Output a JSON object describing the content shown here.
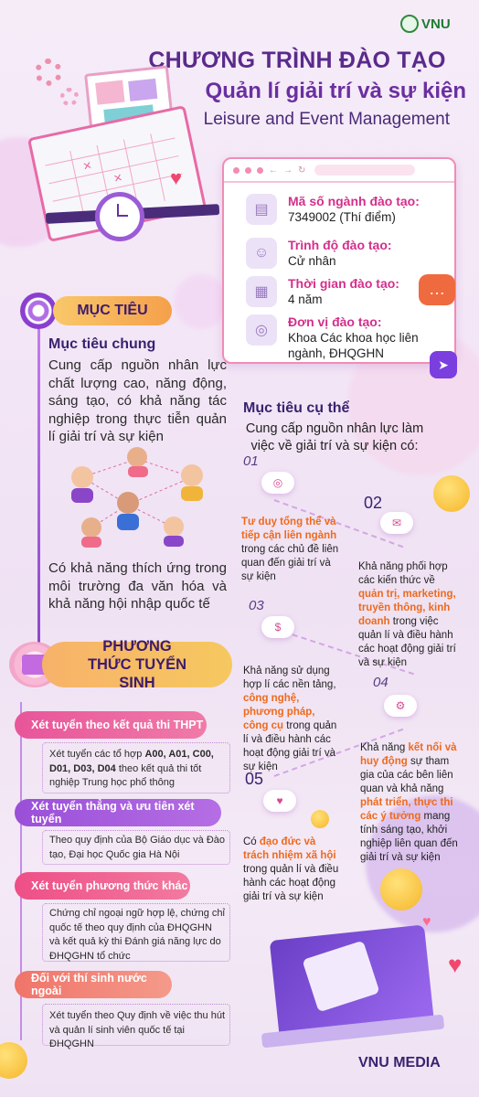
{
  "header": {
    "logo_text": "VNU",
    "title_line1": "CHƯƠNG TRÌNH ĐÀO TẠO",
    "title_line2": "Quản lí giải trí và sự kiện",
    "title_line3": "Leisure and Event Management"
  },
  "info_card": {
    "items": [
      {
        "icon": "document-icon",
        "label": "Mã số ngành đào tạo:",
        "value": "7349002 (Thí điểm)"
      },
      {
        "icon": "graduate-icon",
        "label": "Trình độ đào tạo:",
        "value": "Cử nhân"
      },
      {
        "icon": "calendar-icon",
        "label": "Thời gian đào tạo:",
        "value": "4 năm"
      },
      {
        "icon": "school-logo-icon",
        "label": "Đơn vị đào tạo:",
        "value": "Khoa Các khoa học liên ngành, ĐHQGHN"
      }
    ]
  },
  "goals": {
    "section_title": "MỤC TIÊU",
    "general_title": "Mục tiêu chung",
    "general_text1": "Cung cấp nguồn nhân lực chất lượng cao, năng động, sáng tạo, có khả năng tác nghiệp trong thực tiễn quản lí giải trí và sự kiện",
    "general_text2": "Có khả năng thích ứng trong môi trường đa văn hóa và khả năng hội nhập quốc tế"
  },
  "specific": {
    "title": "Mục tiêu cụ thể",
    "intro": "Cung cấp nguồn nhân lực làm việc về giải trí và sự kiện có:",
    "items": [
      {
        "num": "01",
        "pre": "",
        "hl": "Tư duy tổng thể và tiếp cận liên ngành",
        "post": " trong các chủ đề liên quan đến giải trí và sự kiện"
      },
      {
        "num": "02",
        "pre": "Khả năng phối hợp các kiến thức về ",
        "hl": "quản trị, marketing, truyền thông, kinh doanh",
        "post": " trong việc quản lí và điều hành các hoạt động giải trí và sự kiện"
      },
      {
        "num": "03",
        "pre": "Khả năng sử dụng hợp lí các nền tảng, ",
        "hl": "công nghệ, phương pháp, công cụ",
        "post": " trong quản lí và điều hành các hoạt động giải trí và sự kiện"
      },
      {
        "num": "04",
        "pre": "Khả năng ",
        "hl": "kết nối và huy động",
        "post": " sự tham gia của các bên liên quan và khả năng ",
        "hl2": "phát triển, thực thi các ý tưởng",
        "post2": " mang tính sáng tạo, khởi nghiệp liên quan đến giải trí và sự kiện"
      },
      {
        "num": "05",
        "pre": "Có ",
        "hl": "đạo đức và trách nhiệm xã hội",
        "post": " trong quản lí và điều hành các hoạt động giải trí và sự kiện"
      }
    ]
  },
  "admission": {
    "title": "PHƯƠNG THỨC TUYỂN SINH",
    "methods": [
      {
        "label": "Xét tuyển theo kết quả thi THPT",
        "color": "#e8559a",
        "desc_pre": "Xét tuyển các tổ hợp ",
        "desc_bold": "A00, A01, C00, D01, D03, D04",
        "desc_post": " theo kết quả thi tốt nghiệp Trung học phổ thông"
      },
      {
        "label": "Xét tuyển thẳng và ưu tiên xét tuyển",
        "color": "#a04fd8",
        "desc_pre": "Theo quy định của Bộ Giáo dục và Đào tạo, Đại học Quốc gia Hà Nội",
        "desc_bold": "",
        "desc_post": ""
      },
      {
        "label": "Xét tuyển phương thức khác",
        "color": "#ee4f86",
        "desc_pre": "Chứng chỉ ngoại ngữ hợp lệ, chứng chỉ quốc tế theo quy định của ĐHQGHN và kết quả kỳ thi Đánh giá năng lực do ĐHQGHN tổ chức",
        "desc_bold": "",
        "desc_post": ""
      },
      {
        "label": "Đối với thí sinh nước ngoài",
        "color": "#f0746a",
        "desc_pre": "Xét tuyển theo Quy định về việc thu hút và quản lí sinh viên quốc tế tại ĐHQGHN",
        "desc_bold": "",
        "desc_post": ""
      }
    ]
  },
  "footer": {
    "brand": "VNU MEDIA"
  },
  "colors": {
    "accent_purple": "#6a2fa0",
    "highlight_orange": "#ee6a1d",
    "label_pink": "#d42f8c"
  }
}
